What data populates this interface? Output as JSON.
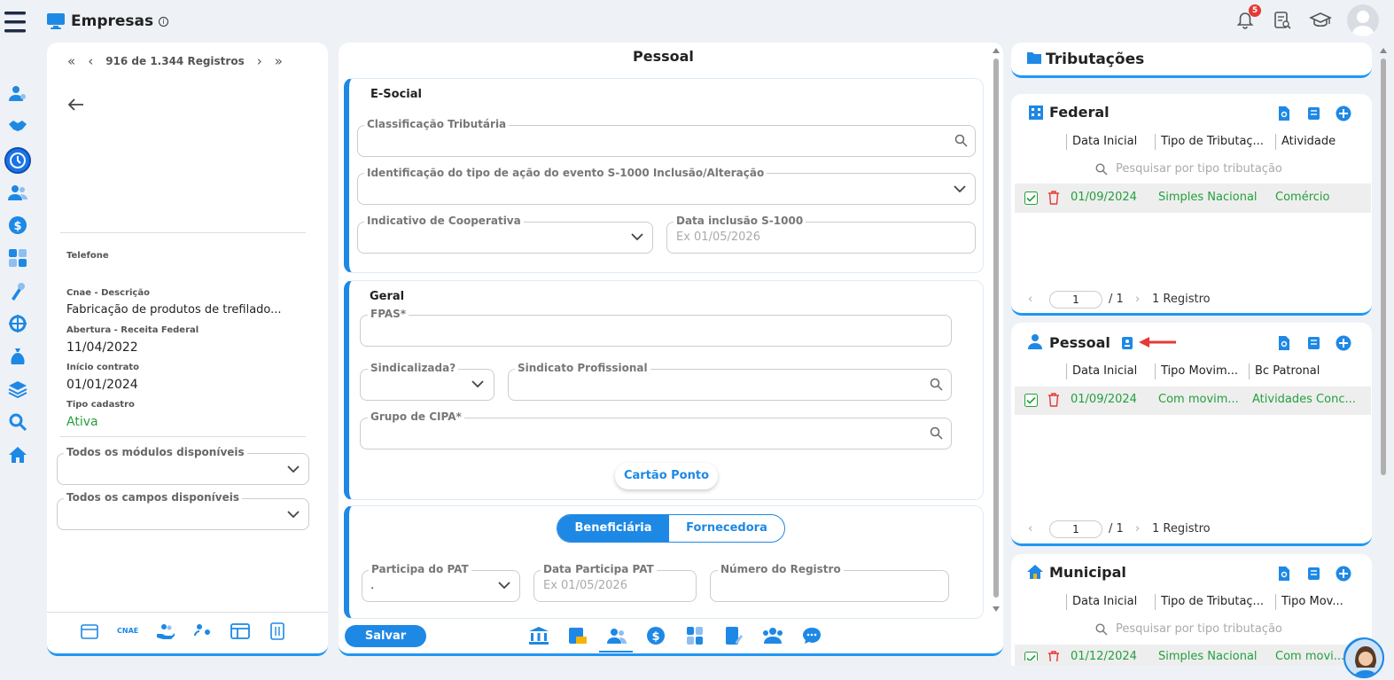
{
  "app": {
    "title": "Empresas",
    "notifications_count": "5"
  },
  "left": {
    "pager": {
      "first": "«",
      "prev": "‹",
      "text": "916 de 1.344 Registros",
      "next": "›",
      "last": "»"
    },
    "fields": {
      "telefone_label": "Telefone",
      "cnae_label": "Cnae - Descrição",
      "cnae_value": "Fabricação de produtos de trefilado...",
      "abertura_label": "Abertura - Receita Federal",
      "abertura_value": "11/04/2022",
      "inicio_label": "Início contrato",
      "inicio_value": "01/01/2024",
      "tipo_label": "Tipo cadastro",
      "tipo_value": "Ativa"
    },
    "modulos_label": "Todos os módulos disponíveis",
    "campos_label": "Todos os campos disponíveis",
    "bottom_cnae": "CNAE"
  },
  "middle": {
    "title": "Pessoal",
    "esocial": {
      "title": "E-Social",
      "classificacao": "Classificação Tributária",
      "identificacao": "Identificação do tipo de ação do evento S-1000 Inclusão/Alteração",
      "cooperativa": "Indicativo de Cooperativa",
      "data_inclusao": "Data inclusão S-1000",
      "data_inclusao_ph": "Ex 01/05/2026"
    },
    "geral": {
      "title": "Geral",
      "fpas": "FPAS*",
      "sindicalizada": "Sindicalizada?",
      "sindicato": "Sindicato Profissional",
      "cipa": "Grupo de CIPA*",
      "cartao": "Cartão Ponto"
    },
    "pat": {
      "tab_active": "Beneficiária",
      "tab_other": "Fornecedora",
      "participa": "Participa do PAT",
      "participa_value": ".",
      "data_participa": "Data Participa PAT",
      "data_participa_ph": "Ex 01/05/2026",
      "numero": "Número do Registro"
    },
    "save": "Salvar"
  },
  "right": {
    "title": "Tributações",
    "federal": {
      "title": "Federal",
      "cols": [
        "Data Inicial",
        "Tipo de Tributaç...",
        "Atividade"
      ],
      "search": "Pesquisar por tipo tributação",
      "row": [
        "01/09/2024",
        "Simples Nacional",
        "Comércio"
      ],
      "page": "1",
      "of": "/ 1",
      "count": "1 Registro"
    },
    "pessoal": {
      "title": "Pessoal",
      "cols": [
        "Data Inicial",
        "Tipo Movim...",
        "Bc Patronal"
      ],
      "row": [
        "01/09/2024",
        "Com movim...",
        "Atividades Conc..."
      ],
      "page": "1",
      "of": "/ 1",
      "count": "1 Registro"
    },
    "municipal": {
      "title": "Municipal",
      "cols": [
        "Data Inicial",
        "Tipo de Tributaç...",
        "Tipo Mov..."
      ],
      "search": "Pesquisar por tipo tributação",
      "row": [
        "01/12/2024",
        "Simples Nacional",
        "Com movi..."
      ]
    }
  },
  "colors": {
    "accent": "#1e88e5",
    "green": "#23a03c",
    "red": "#e53935"
  }
}
